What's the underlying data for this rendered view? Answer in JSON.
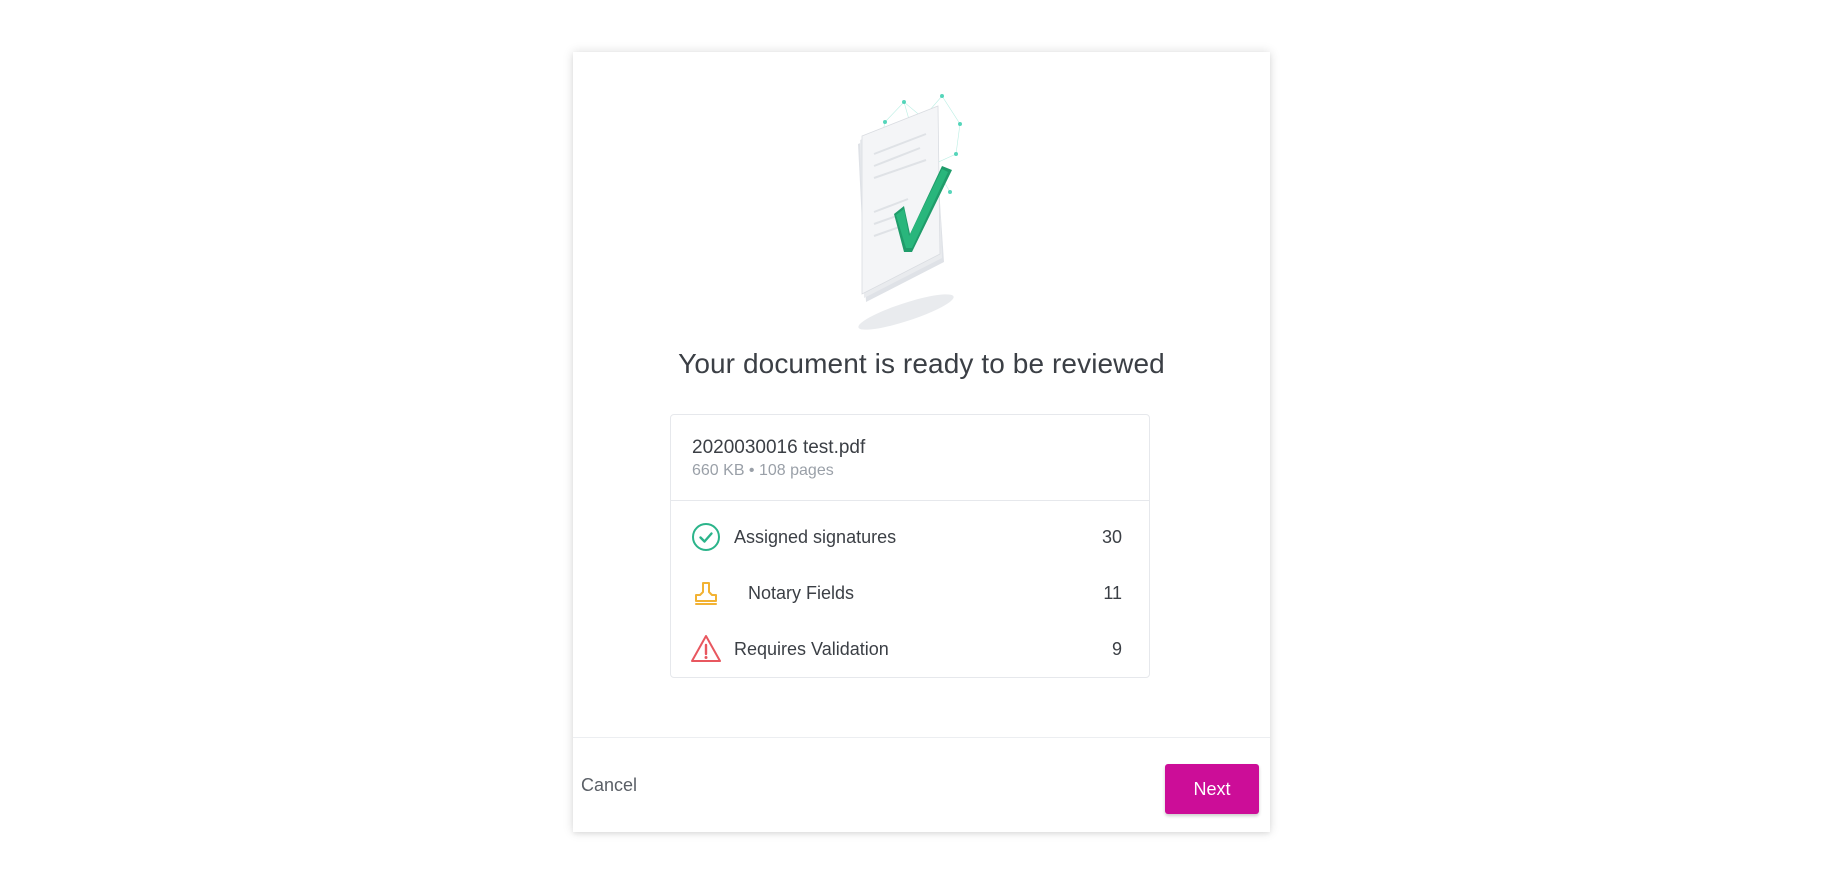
{
  "dialog": {
    "title": "Your document is ready to be reviewed",
    "illustration_icon": "document-checkmark-illustration"
  },
  "file": {
    "name": "2020030016 test.pdf",
    "meta": "660 KB • 108 pages"
  },
  "stats": [
    {
      "icon": "check-circle-icon",
      "label": "Assigned signatures",
      "count": "30",
      "color": "#2bb48a"
    },
    {
      "icon": "stamp-icon",
      "label": "Notary Fields",
      "count": "11",
      "color": "#f2b233"
    },
    {
      "icon": "warning-icon",
      "label": "Requires Validation",
      "count": "9",
      "color": "#e8575f"
    }
  ],
  "footer": {
    "cancel_label": "Cancel",
    "next_label": "Next"
  },
  "colors": {
    "accent": "#cc0d98",
    "success": "#2bb48a",
    "notary": "#f2b233",
    "warning": "#e8575f"
  }
}
